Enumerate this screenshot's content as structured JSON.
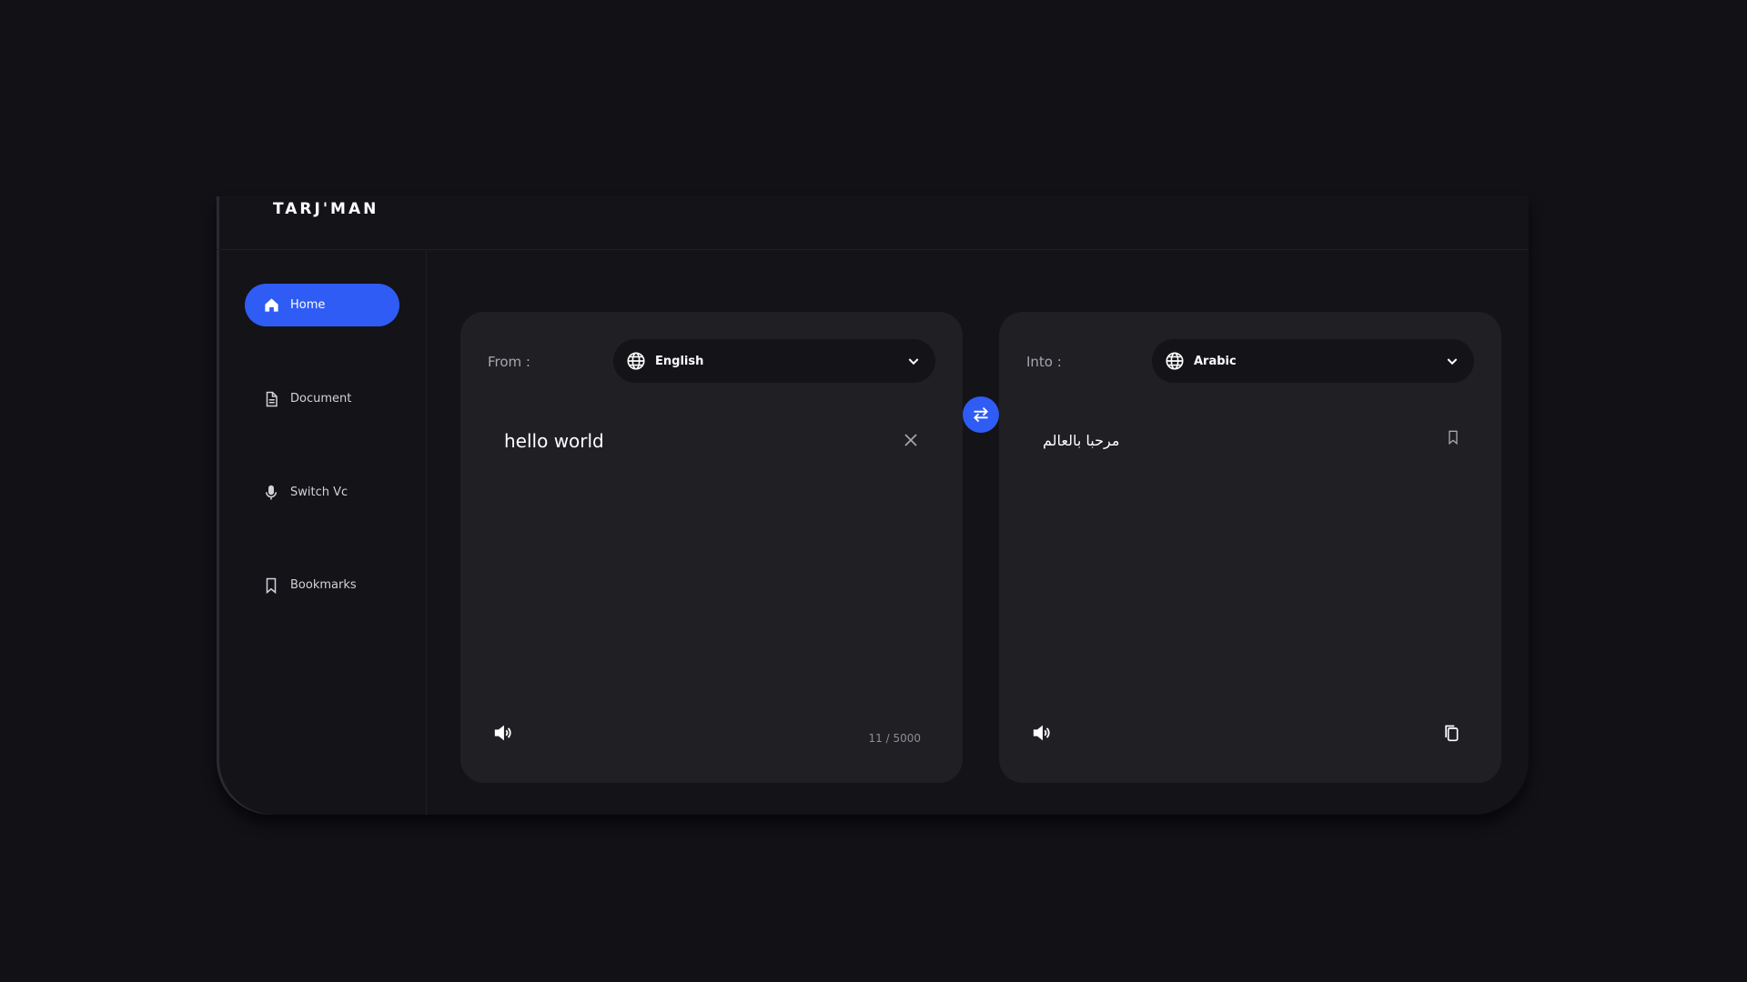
{
  "app": {
    "brand": "TARJ'MAN"
  },
  "sidebar": {
    "items": [
      {
        "label": "Home",
        "icon": "home-icon",
        "active": true
      },
      {
        "label": "Document",
        "icon": "document-icon",
        "active": false
      },
      {
        "label": "Switch Vc",
        "icon": "microphone-icon",
        "active": false
      },
      {
        "label": "Bookmarks",
        "icon": "bookmark-icon",
        "active": false
      }
    ]
  },
  "source": {
    "label": "From :",
    "language": "English",
    "text": "hello world",
    "counter": "11 / 5000"
  },
  "target": {
    "label": "Into :",
    "language": "Arabic",
    "text": "مرحبا بالعالم"
  },
  "colors": {
    "accent": "#2f5cf5",
    "background": "#111116",
    "panel": "#1f1f24"
  }
}
